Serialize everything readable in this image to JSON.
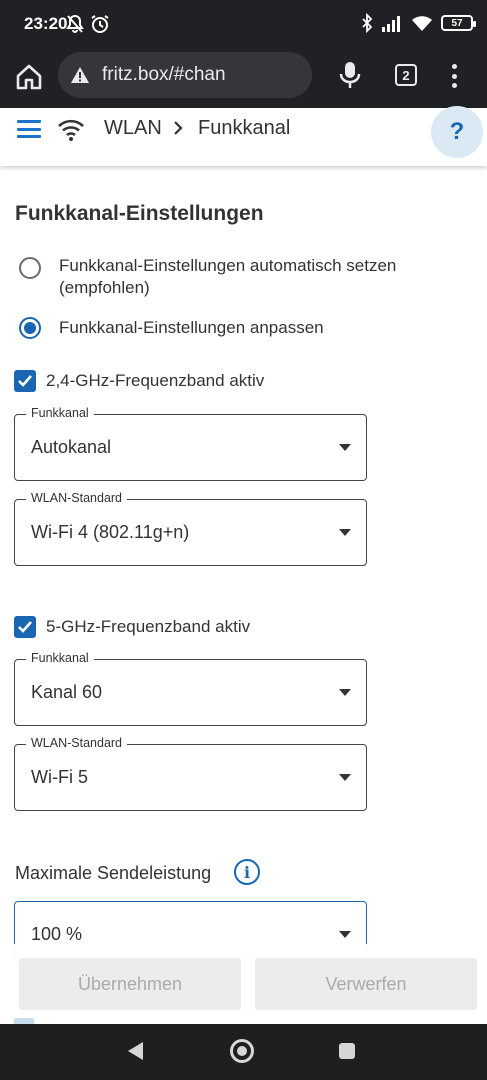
{
  "status_bar": {
    "time": "23:20",
    "battery": "57",
    "icons": [
      "mute-icon",
      "alarm-icon",
      "bluetooth-icon",
      "signal-icon",
      "wifi-icon",
      "battery-icon"
    ]
  },
  "browser": {
    "url": "fritz.box/#chan",
    "tab_count": "2",
    "icons": [
      "home-icon",
      "warning-icon",
      "microphone-icon",
      "tabs-icon",
      "more-vert-icon"
    ]
  },
  "header": {
    "breadcrumb": [
      "WLAN",
      "Funkkanal"
    ],
    "help_label": "?"
  },
  "main": {
    "title": "Funkkanal-Einstellungen",
    "options": [
      {
        "label": "Funkkanal-Einstellungen automatisch setzen (empfohlen)",
        "selected": false
      },
      {
        "label": "Funkkanal-Einstellungen anpassen",
        "selected": true
      }
    ],
    "band24": {
      "label": "2,4-GHz-Frequenzband aktiv",
      "checked": true,
      "channel_label": "Funkkanal",
      "channel_value": "Autokanal",
      "standard_label": "WLAN-Standard",
      "standard_value": "Wi-Fi 4 (802.11g+n)"
    },
    "band5": {
      "label": "5-GHz-Frequenzband aktiv",
      "checked": true,
      "channel_label": "Funkkanal",
      "channel_value": "Kanal 60",
      "standard_label": "WLAN-Standard",
      "standard_value": "Wi-Fi 5"
    },
    "power": {
      "label": "Maximale Sendeleistung",
      "value": "100 %"
    }
  },
  "actions": {
    "apply": "Übernehmen",
    "discard": "Verwerfen"
  },
  "colors": {
    "accent": "#1a66b3",
    "chrome": "#202124"
  }
}
